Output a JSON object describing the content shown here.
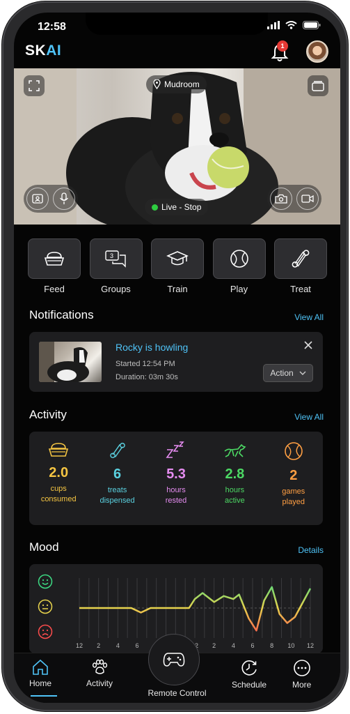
{
  "status_bar": {
    "time": "12:58"
  },
  "header": {
    "logo_main": "SK",
    "logo_accent": "AI",
    "notification_count": "1"
  },
  "camera": {
    "location": "Mudroom",
    "live_label": "Live - Stop",
    "live_color": "#2ecc40"
  },
  "quick_actions": [
    {
      "label": "Feed",
      "icon": "bowl-icon"
    },
    {
      "label": "Groups",
      "icon": "chat-bubbles-icon",
      "count": "3"
    },
    {
      "label": "Train",
      "icon": "graduation-cap-icon"
    },
    {
      "label": "Play",
      "icon": "ball-icon"
    },
    {
      "label": "Treat",
      "icon": "bone-icon"
    }
  ],
  "notifications": {
    "title": "Notifications",
    "view_all": "View All",
    "item": {
      "title": "Rocky is howling",
      "started": "Started 12:54 PM",
      "duration": "Duration: 03m 30s",
      "action_label": "Action"
    }
  },
  "activity": {
    "title": "Activity",
    "view_all": "View All",
    "stats": [
      {
        "value": "2.0",
        "label_1": "cups",
        "label_2": "consumed",
        "color": "#f5c542",
        "icon": "bowl-icon"
      },
      {
        "value": "6",
        "label_1": "treats",
        "label_2": "dispensed",
        "color": "#5ad1e0",
        "icon": "bone-icon"
      },
      {
        "value": "5.3",
        "label_1": "hours",
        "label_2": "rested",
        "color": "#e58cf0",
        "icon": "sleep-zzz-icon"
      },
      {
        "value": "2.8",
        "label_1": "hours",
        "label_2": "active",
        "color": "#4cd964",
        "icon": "running-dog-icon"
      },
      {
        "value": "2",
        "label_1": "games",
        "label_2": "played",
        "color": "#ff9f43",
        "icon": "ball-icon"
      }
    ]
  },
  "mood": {
    "title": "Mood",
    "details": "Details",
    "colors": {
      "happy": "#3ddc84",
      "neutral": "#e8d44d",
      "sad": "#ff4d4d"
    }
  },
  "chart_data": {
    "type": "line",
    "x_ticks": [
      "12",
      "2",
      "4",
      "6",
      "8",
      "10",
      "12",
      "2",
      "4",
      "6",
      "8",
      "10",
      "12"
    ],
    "y_categories": [
      "sad",
      "neutral",
      "happy"
    ],
    "ylim": [
      0,
      2
    ],
    "series": [
      {
        "values": [
          [
            0,
            1.0
          ],
          [
            1.5,
            1.0
          ],
          [
            2.7,
            1.0
          ],
          [
            3.2,
            0.85
          ],
          [
            3.7,
            1.0
          ],
          [
            5.7,
            1.0
          ],
          [
            6.0,
            1.3
          ],
          [
            6.4,
            1.5
          ],
          [
            7.0,
            1.2
          ],
          [
            7.5,
            1.4
          ],
          [
            8.0,
            1.3
          ],
          [
            8.3,
            1.45
          ],
          [
            8.8,
            0.65
          ],
          [
            9.2,
            0.25
          ],
          [
            9.6,
            1.25
          ],
          [
            10.0,
            1.7
          ],
          [
            10.4,
            0.8
          ],
          [
            10.8,
            0.5
          ],
          [
            11.2,
            0.7
          ],
          [
            12.0,
            1.65
          ]
        ]
      }
    ],
    "grid": true
  },
  "bottom_nav": {
    "home": "Home",
    "activity": "Activity",
    "remote": "Remote Control",
    "schedule": "Schedule",
    "more": "More",
    "accent": "#4fc3f7"
  }
}
